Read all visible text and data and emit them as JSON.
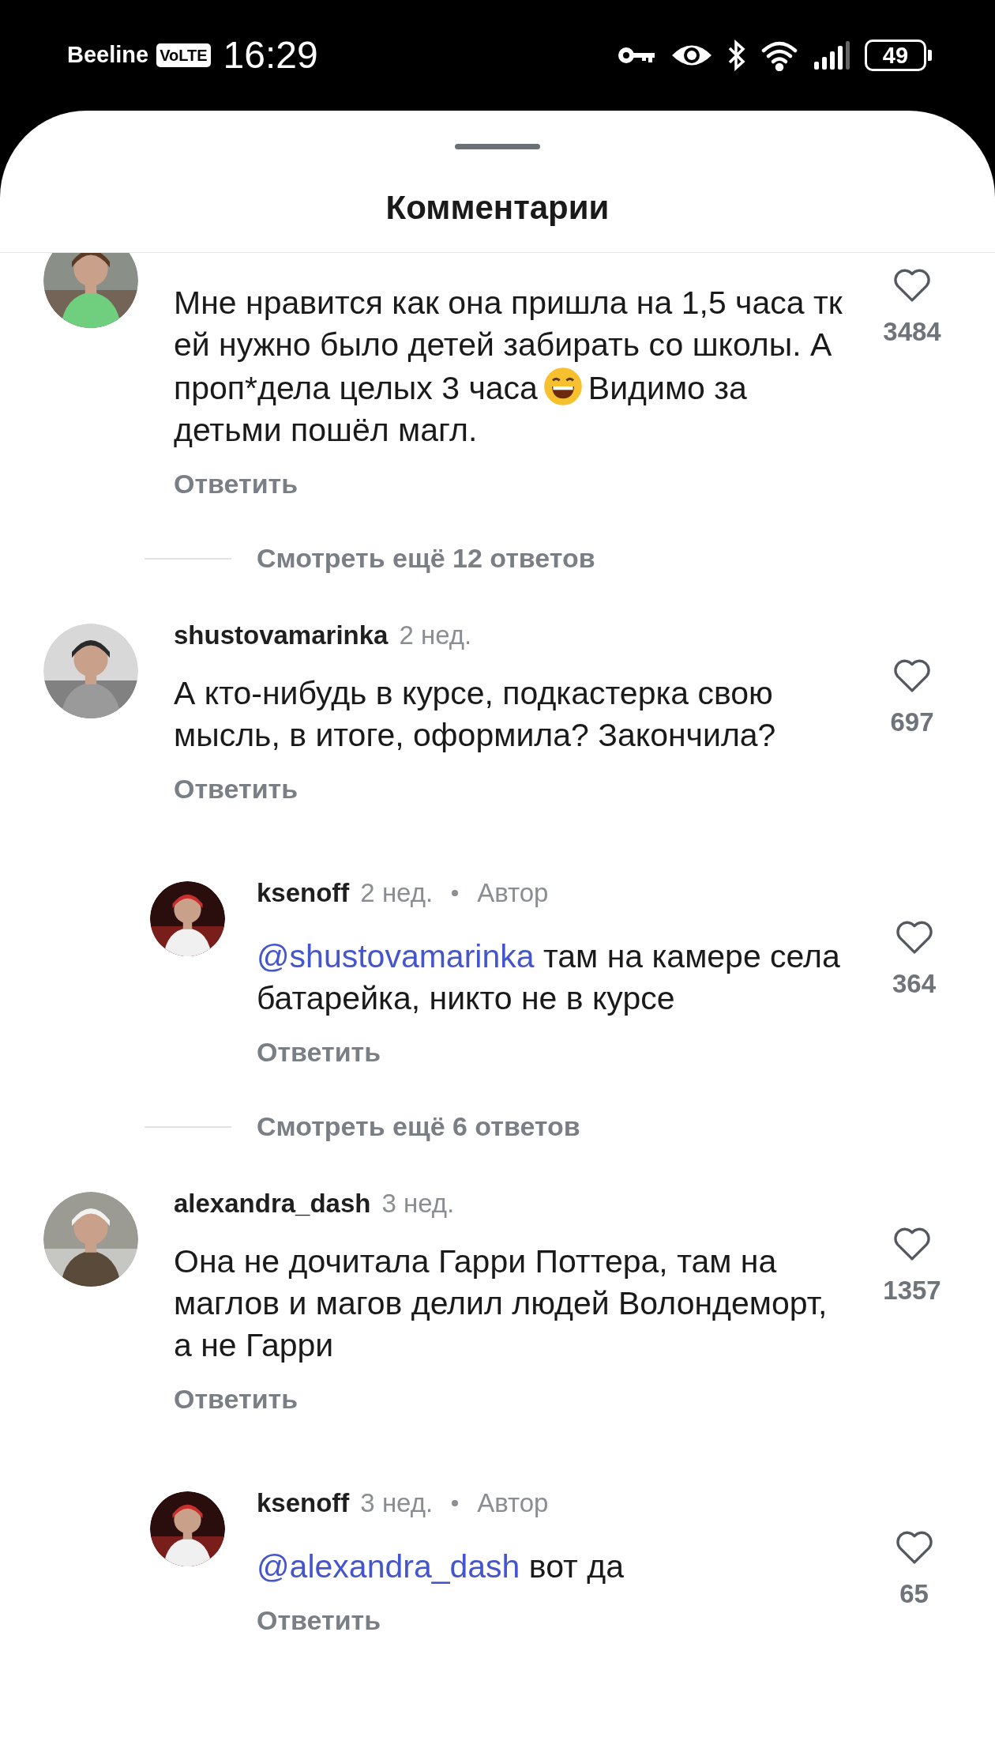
{
  "status_bar": {
    "carrier": "Beeline",
    "network_badge": "VoLTE",
    "time": "16:29",
    "battery": "49"
  },
  "sheet": {
    "title": "Комментарии"
  },
  "items": [
    {
      "kind": "comment",
      "text": "Мне нравится как она пришла на 1,5 часа тк ей нужно было детей забирать со школы. А проп*дела целых 3 часа",
      "text_after_emoji": "Видимо за детьми пошёл магл.",
      "likes": "3484",
      "reply_action": "Ответить"
    },
    {
      "kind": "more",
      "label": "Смотреть ещё 12 ответов"
    },
    {
      "kind": "comment",
      "username": "shustovamarinka",
      "time": "2 нед.",
      "text": "А кто-нибудь в курсе, подкастерка свою мысль, в итоге, оформила? Закончила?",
      "likes": "697",
      "reply_action": "Ответить"
    },
    {
      "kind": "reply",
      "username": "ksenoff",
      "time": "2 нед.",
      "author_badge": "Автор",
      "mention": "@shustovamarinka",
      "text": "там на камере села батарейка, никто не в курсе",
      "likes": "364",
      "reply_action": "Ответить"
    },
    {
      "kind": "more",
      "label": "Смотреть ещё 6 ответов"
    },
    {
      "kind": "comment",
      "username": "alexandra_dash",
      "time": "3 нед.",
      "text": "Она не дочитала Гарри Поттера, там на маглов и магов делил людей Волондеморт, а не Гарри",
      "likes": "1357",
      "reply_action": "Ответить"
    },
    {
      "kind": "reply",
      "username": "ksenoff",
      "time": "3 нед.",
      "author_badge": "Автор",
      "mention": "@alexandra_dash",
      "text": "вот да",
      "likes": "65",
      "reply_action": "Ответить"
    }
  ]
}
